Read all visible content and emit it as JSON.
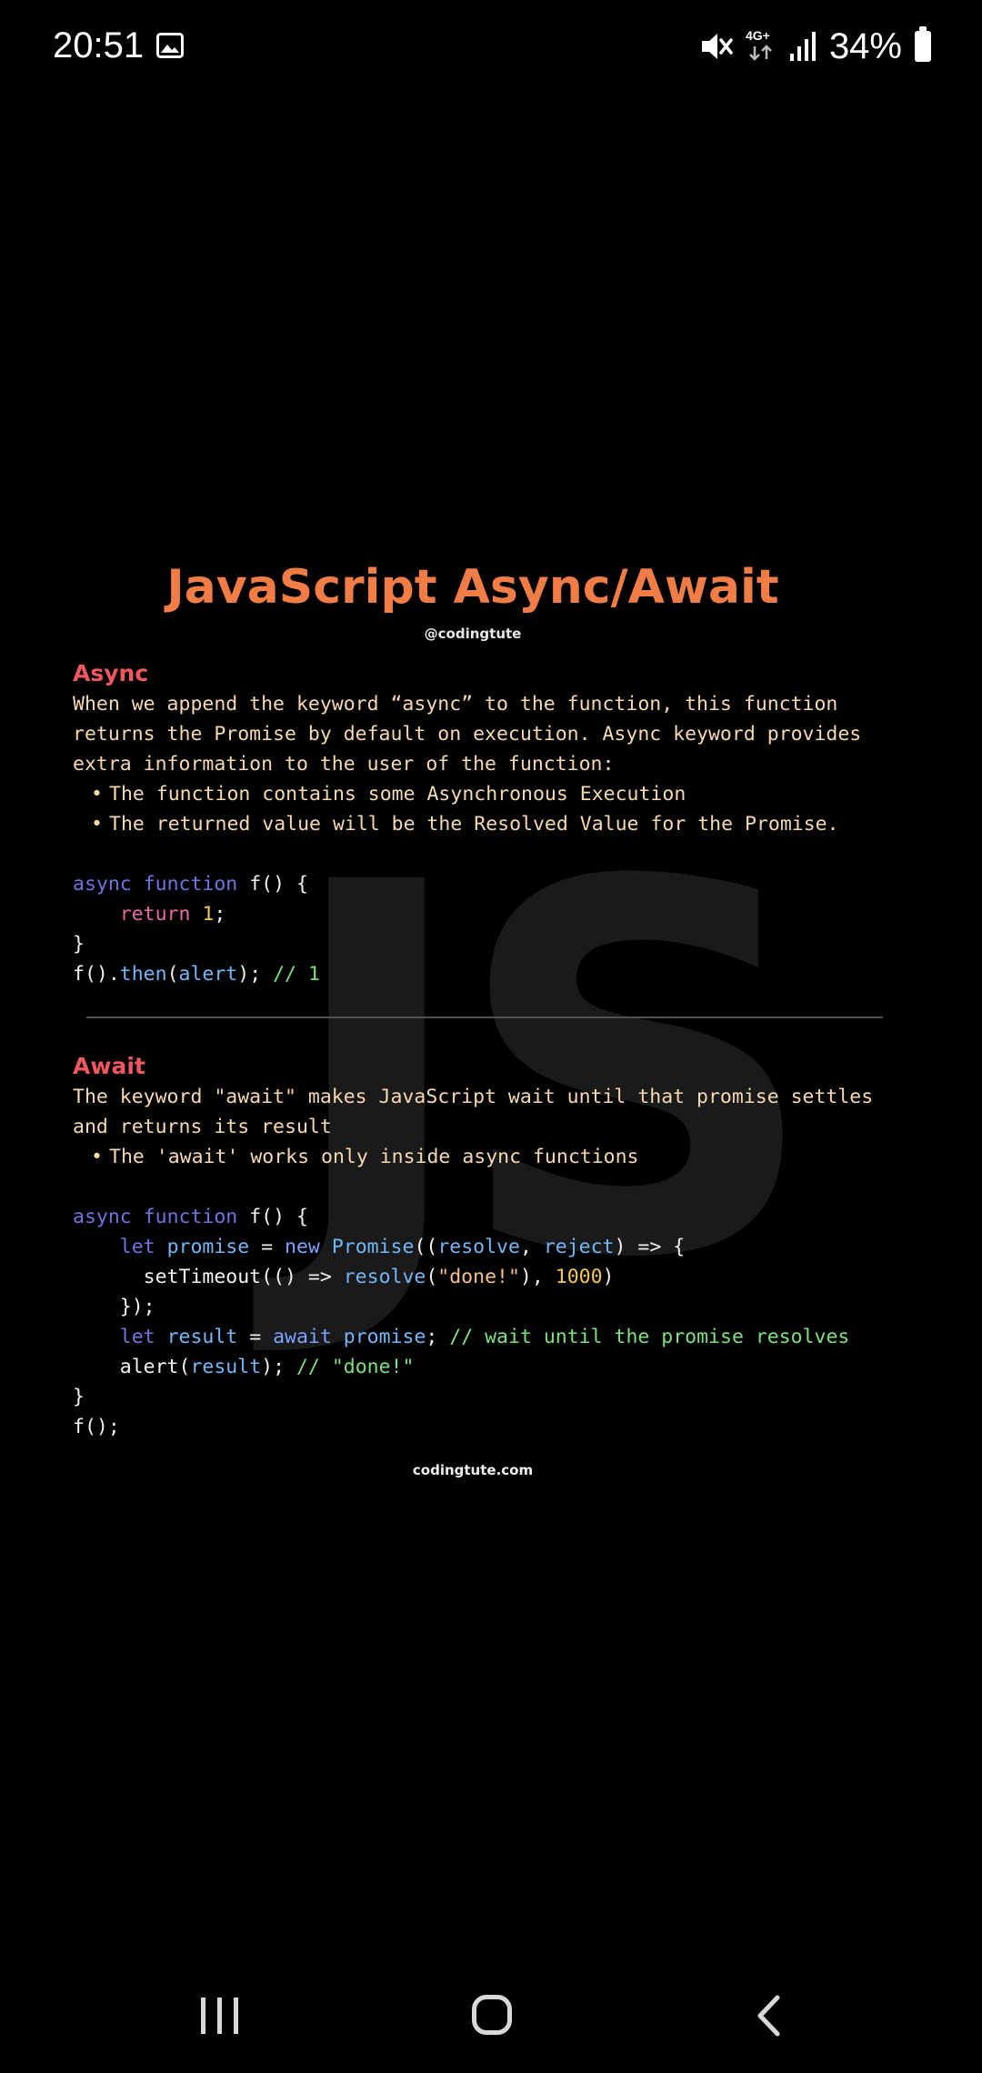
{
  "status_bar": {
    "time": "20:51",
    "network_label": "4G+",
    "battery": "34%",
    "icons": [
      "gallery-icon",
      "mute-icon",
      "network-4g-icon",
      "signal-icon",
      "battery-icon"
    ]
  },
  "card": {
    "title": "JavaScript Async/Await",
    "handle": "@codingtute",
    "watermark": "JS",
    "async_section": {
      "heading": "Async",
      "description": "When we append the keyword “async” to the function, this function\nreturns the Promise by default on execution. Async keyword provides\nextra information to the user of the function:",
      "bullets": [
        "The function contains some Asynchronous Execution",
        "The returned value will be the Resolved Value for the Promise."
      ]
    },
    "await_section": {
      "heading": "Await",
      "description": "The keyword \"await\" makes JavaScript wait until that promise settles\nand returns its result",
      "bullets": [
        "The 'await' works only inside async functions"
      ]
    },
    "footer": "codingtute.com"
  },
  "colors": {
    "title": "#f07c46",
    "heading": "#f0575f",
    "text": "#f6d9b0",
    "background": "#000000"
  },
  "nav_bar": {
    "icons": [
      "recent-apps-icon",
      "home-icon",
      "back-icon"
    ]
  }
}
